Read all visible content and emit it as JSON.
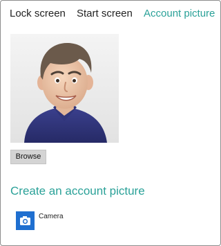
{
  "tabs": [
    {
      "label": "Lock screen",
      "active": false
    },
    {
      "label": "Start screen",
      "active": false
    },
    {
      "label": "Account picture",
      "active": true
    }
  ],
  "account_picture": {
    "icon": "avatar-icon"
  },
  "browse_label": "Browse",
  "create_section": {
    "title": "Create an account picture",
    "apps": [
      {
        "label": "Camera",
        "icon": "camera-icon"
      }
    ]
  },
  "colors": {
    "accent": "#2aa198",
    "camera_tile": "#1f6fd0",
    "button_bg": "#d4d4d4"
  }
}
